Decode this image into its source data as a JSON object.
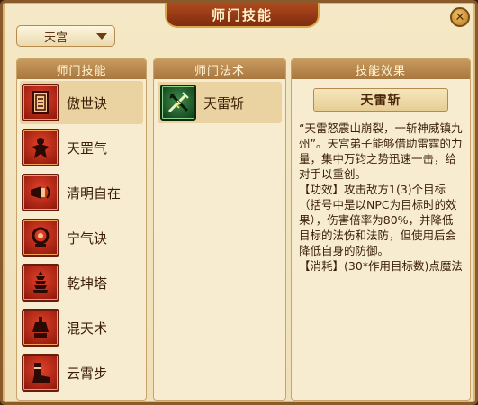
{
  "window": {
    "title": "师门技能",
    "close_glyph": "✕"
  },
  "school_select": {
    "value": "天宫"
  },
  "skills_panel": {
    "header": "师门技能",
    "items": [
      {
        "label": "傲世诀",
        "icon": "scroll-icon",
        "selected": true
      },
      {
        "label": "天罡气",
        "icon": "warrior-icon",
        "selected": false
      },
      {
        "label": "清明自在",
        "icon": "horn-icon",
        "selected": false
      },
      {
        "label": "宁气诀",
        "icon": "orb-icon",
        "selected": false
      },
      {
        "label": "乾坤塔",
        "icon": "pagoda-icon",
        "selected": false
      },
      {
        "label": "混天术",
        "icon": "vessel-icon",
        "selected": false
      },
      {
        "label": "云霄步",
        "icon": "boot-icon",
        "selected": false
      }
    ]
  },
  "spells_panel": {
    "header": "师门法术",
    "items": [
      {
        "label": "天雷斩",
        "icon": "thunder-sword-icon"
      }
    ]
  },
  "effect_panel": {
    "header": "技能效果",
    "name": "天雷斩",
    "description": "“天雷怒震山崩裂，一斩神威镇九州”。天宫弟子能够借助雷霆的力量，集中万钧之势迅速一击，给对手以重创。\n【功效】攻击敌方1(3)个目标（括号中是以NPC为目标时的效果），伤害倍率为80%，并降低目标的法伤和法防，但使用后会降低自身的防御。\n【消耗】(30*作用目标数)点魔法"
  },
  "colors": {
    "frame": "#8a5a2a",
    "parchment": "#f4e8c6",
    "header": "#a87740",
    "skill_icon": "#c2301c",
    "spell_icon": "#2f6e38"
  }
}
